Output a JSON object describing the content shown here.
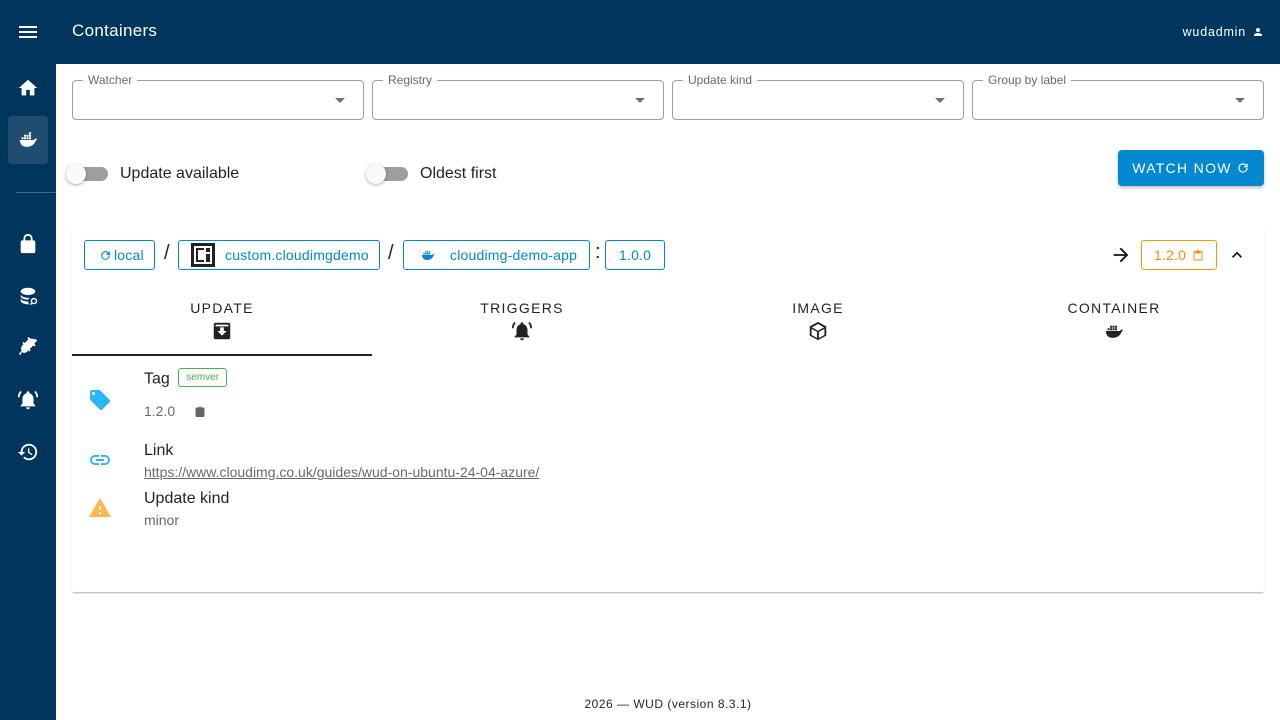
{
  "appbar": {
    "title": "Containers",
    "user": "wudadmin"
  },
  "sidebar": {
    "items": [
      {
        "icon": "home-icon"
      },
      {
        "icon": "docker-icon",
        "active": true
      },
      {
        "icon": "lock-icon"
      },
      {
        "icon": "registry-search-icon"
      },
      {
        "icon": "plug-icon"
      },
      {
        "icon": "bell-icon"
      },
      {
        "icon": "history-icon"
      }
    ]
  },
  "filters": {
    "watcher": {
      "label": "Watcher",
      "value": ""
    },
    "registry": {
      "label": "Registry",
      "value": ""
    },
    "update_kind": {
      "label": "Update kind",
      "value": ""
    },
    "group_by_label": {
      "label": "Group by label",
      "value": ""
    }
  },
  "toggles": {
    "update_available": {
      "label": "Update available",
      "on": false
    },
    "oldest_first": {
      "label": "Oldest first",
      "on": false
    }
  },
  "watch_now": "WATCH NOW",
  "container": {
    "watcher": "local",
    "registry": "custom.cloudimgdemo",
    "image": "cloudimg-demo-app",
    "current_tag": "1.0.0",
    "new_tag": "1.2.0",
    "sep_slash": "/",
    "sep_colon": ":"
  },
  "tabs": [
    {
      "label": "UPDATE",
      "icon": "update-box-icon",
      "active": true
    },
    {
      "label": "TRIGGERS",
      "icon": "bell-ring-icon"
    },
    {
      "label": "IMAGE",
      "icon": "package-icon"
    },
    {
      "label": "CONTAINER",
      "icon": "docker-icon"
    }
  ],
  "details": {
    "tag": {
      "title": "Tag",
      "badge": "semver",
      "value": "1.2.0"
    },
    "link": {
      "title": "Link",
      "url": "https://www.cloudimg.co.uk/guides/wud-on-ubuntu-24-04-azure/"
    },
    "update_kind": {
      "title": "Update kind",
      "value": "minor"
    }
  },
  "colors": {
    "primary": "#00355e",
    "accent": "#0288d1",
    "warning": "#fb8c00",
    "success": "#4caf50"
  },
  "footer": "2026 — WUD (version 8.3.1)"
}
